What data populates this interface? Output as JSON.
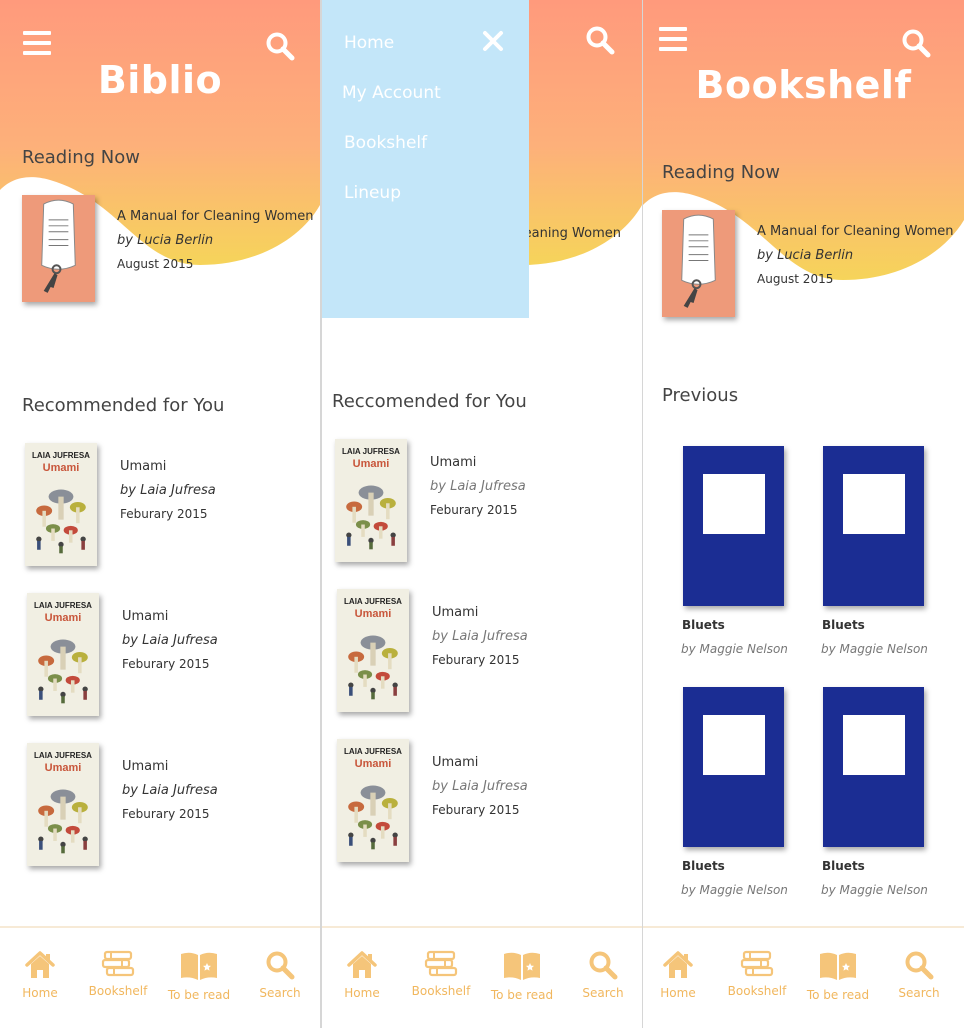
{
  "colors": {
    "gradient_top": "#ff9a7c",
    "gradient_bottom": "#f6d45a",
    "accent": "#f1b75e",
    "menu_bg": "#c3e6f9"
  },
  "home_screen": {
    "title": "Biblio",
    "reading_now_heading": "Reading Now",
    "reading_now": {
      "title": "A Manual for Cleaning Women",
      "author": "by Lucia Berlin",
      "date": "August 2015"
    },
    "recommended_heading": "Recommended for You",
    "recommended": [
      {
        "title": "Umami",
        "author": "by Laia Jufresa",
        "date": "Feburary 2015",
        "cover_author": "LAIA JUFRESA",
        "cover_title": "Umami"
      },
      {
        "title": "Umami",
        "author": "by Laia Jufresa",
        "date": "Feburary 2015",
        "cover_author": "LAIA JUFRESA",
        "cover_title": "Umami"
      },
      {
        "title": "Umami",
        "author": "by Laia Jufresa",
        "date": "Feburary 2015",
        "cover_author": "LAIA JUFRESA",
        "cover_title": "Umami"
      }
    ]
  },
  "menu_screen": {
    "menu_items": [
      "Home",
      "My Account",
      "Bookshelf",
      "Lineup"
    ],
    "peek_text": "leaning Women",
    "recommended_heading": "Reccomended for You",
    "recommended": [
      {
        "title": "Umami",
        "author": "by Laia Jufresa",
        "date": "Feburary 2015",
        "cover_author": "LAIA JUFRESA",
        "cover_title": "Umami"
      },
      {
        "title": "Umami",
        "author": "by Laia Jufresa",
        "date": "Feburary 2015",
        "cover_author": "LAIA JUFRESA",
        "cover_title": "Umami"
      },
      {
        "title": "Umami",
        "author": "by Laia Jufresa",
        "date": "Feburary 2015",
        "cover_author": "LAIA JUFRESA",
        "cover_title": "Umami"
      }
    ]
  },
  "shelf_screen": {
    "title": "Bookshelf",
    "reading_now_heading": "Reading Now",
    "reading_now": {
      "title": "A Manual for Cleaning Women",
      "author": "by Lucia Berlin",
      "date": "August 2015"
    },
    "previous_heading": "Previous",
    "previous": [
      {
        "title": "Bluets",
        "author": "by Maggie Nelson"
      },
      {
        "title": "Bluets",
        "author": "by Maggie Nelson"
      },
      {
        "title": "Bluets",
        "author": "by Maggie Nelson"
      },
      {
        "title": "Bluets",
        "author": "by Maggie Nelson"
      }
    ]
  },
  "tabbar": {
    "items": [
      {
        "label": "Home",
        "icon": "home-icon"
      },
      {
        "label": "Bookshelf",
        "icon": "books-stack-icon"
      },
      {
        "label": "To be read",
        "icon": "open-book-icon"
      },
      {
        "label": "Search",
        "icon": "search-icon"
      }
    ]
  }
}
